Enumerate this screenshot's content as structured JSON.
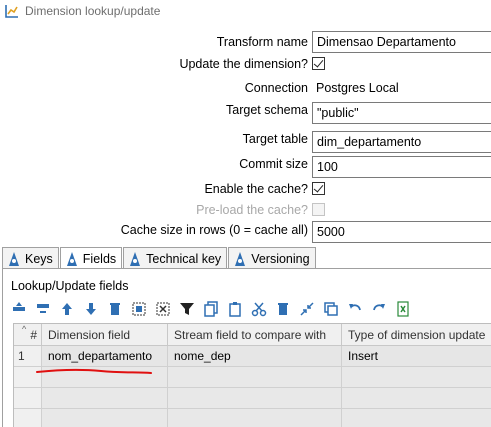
{
  "window": {
    "title": "Dimension lookup/update"
  },
  "form": {
    "transform_name": {
      "label": "Transform name",
      "value": "Dimensao Departamento"
    },
    "update_dimension": {
      "label": "Update the dimension?",
      "checked": true
    },
    "connection": {
      "label": "Connection",
      "value": "Postgres Local"
    },
    "target_schema": {
      "label": "Target schema",
      "value": "\"public\""
    },
    "target_table": {
      "label": "Target table",
      "value": "dim_departamento"
    },
    "commit_size": {
      "label": "Commit size",
      "value": "100"
    },
    "enable_cache": {
      "label": "Enable the cache?",
      "checked": true
    },
    "preload_cache": {
      "label": "Pre-load the cache?",
      "checked": false,
      "disabled": true
    },
    "cache_size": {
      "label": "Cache size in rows (0 = cache all)",
      "value": "5000"
    }
  },
  "tabs": [
    {
      "label": "Keys",
      "active": false
    },
    {
      "label": "Fields",
      "active": true
    },
    {
      "label": "Technical key",
      "active": false
    },
    {
      "label": "Versioning",
      "active": false
    }
  ],
  "lookup": {
    "section_label": "Lookup/Update fields",
    "columns": [
      "#",
      "Dimension field",
      "Stream field to compare with",
      "Type of dimension update"
    ],
    "rows": [
      {
        "num": "1",
        "dimension_field": "nom_departamento",
        "stream_field": "nome_dep",
        "update_type": "Insert"
      }
    ]
  },
  "toolbar_icons": [
    "insert-row-icon",
    "delete-row-icon",
    "move-up-icon",
    "move-down-icon",
    "trash-icon",
    "select-all-icon",
    "clear-selection-icon",
    "filter-icon",
    "copy-icon",
    "paste-icon",
    "cut-icon",
    "delete-icon",
    "collapse-icon",
    "duplicate-icon",
    "undo-icon",
    "redo-icon",
    "export-excel-icon"
  ],
  "colors": {
    "accent": "#1a73b8",
    "annotation_red": "#e01010"
  }
}
